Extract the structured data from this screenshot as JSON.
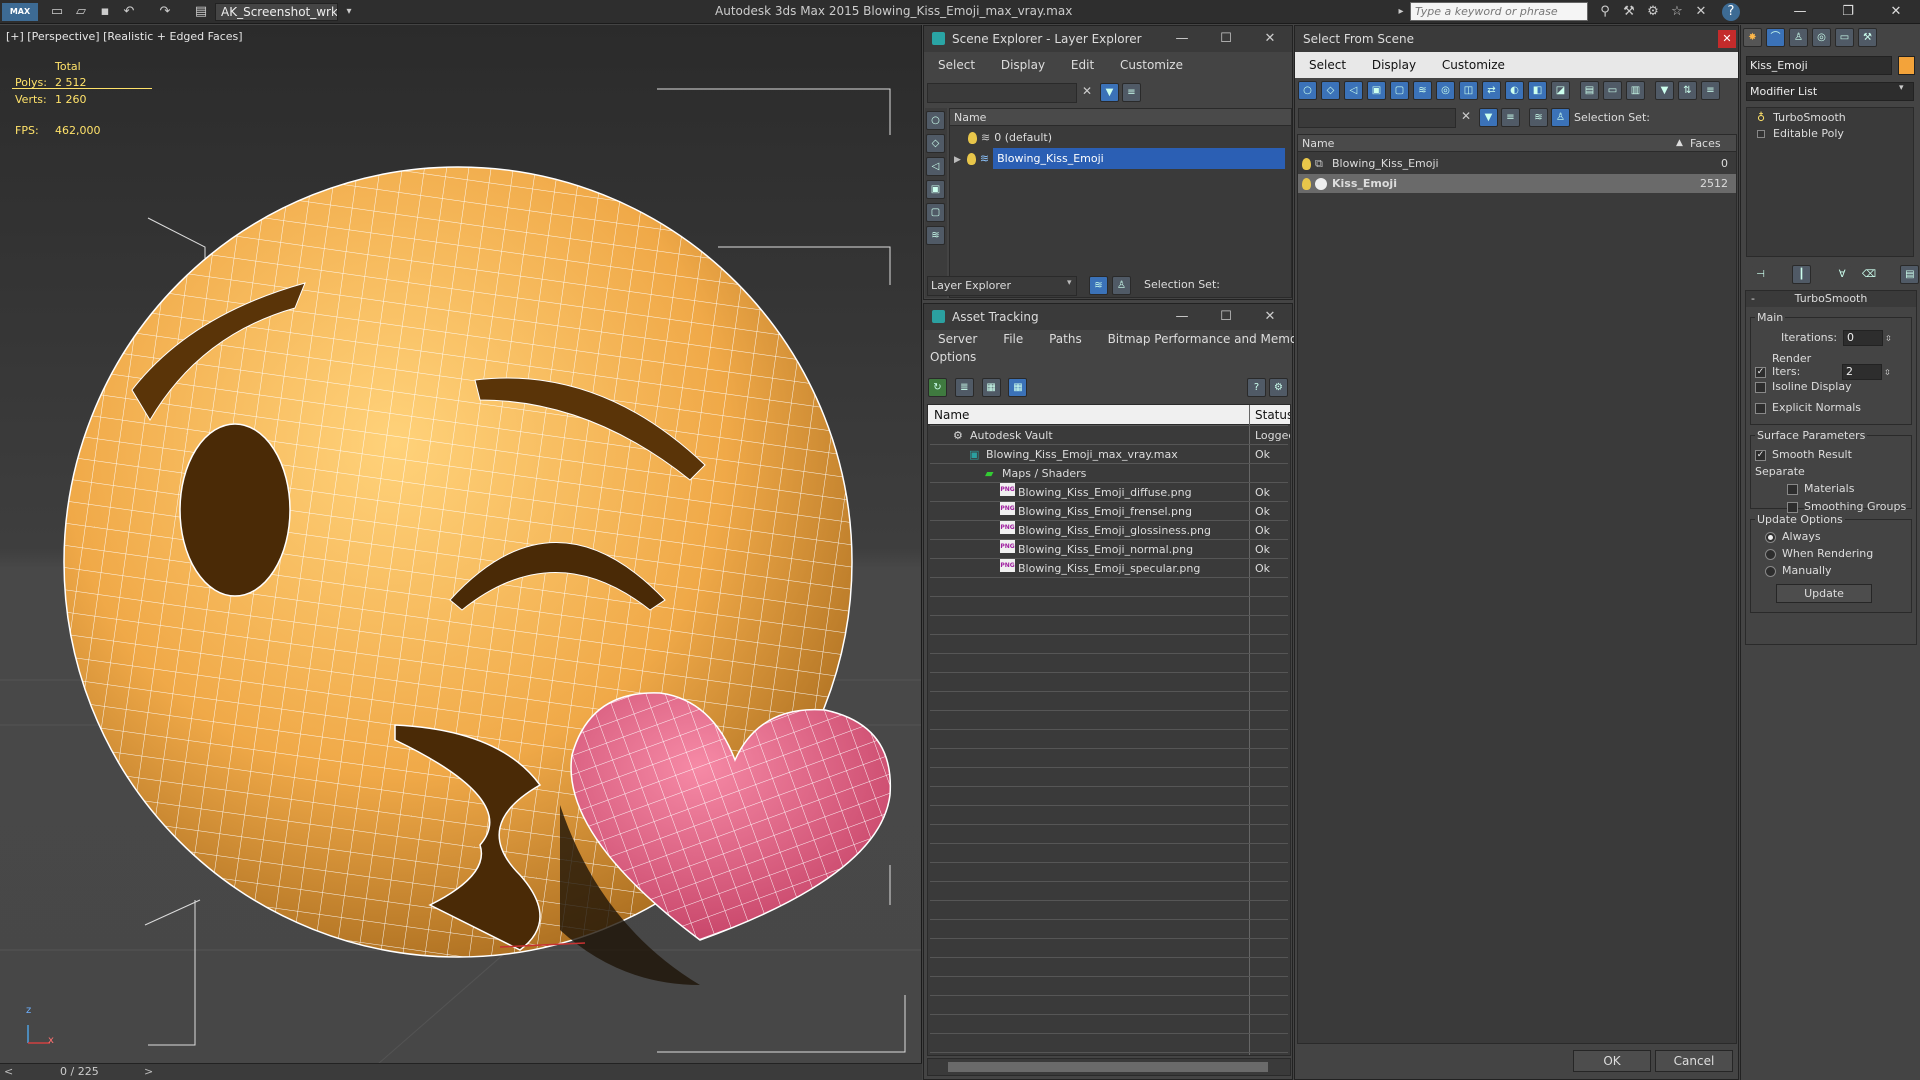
{
  "app": {
    "title": "Autodesk 3ds Max  2015     Blowing_Kiss_Emoji_max_vray.max",
    "logo": "MAX",
    "workspace": "AK_Screenshot_wrksp",
    "search_placeholder": "Type a keyword or phrase"
  },
  "viewport": {
    "label": "[+] [Perspective] [Realistic + Edged Faces]",
    "stats": {
      "total_label": "Total",
      "polys_label": "Polys:",
      "polys_value": "2 512",
      "verts_label": "Verts:",
      "verts_value": "1 260",
      "fps_label": "FPS:",
      "fps_value": "462,000"
    },
    "timeline": "0 / 225",
    "axis_z": "z",
    "axis_x": "x",
    "colors": {
      "emoji": "#f3b04e",
      "heart": "#e0527c",
      "wire": "#ffffff"
    }
  },
  "scene_explorer": {
    "title": "Scene Explorer - Layer Explorer",
    "menu": [
      "Select",
      "Display",
      "Edit",
      "Customize"
    ],
    "column": "Name",
    "rows": [
      {
        "name": "0 (default)"
      },
      {
        "name": "Blowing_Kiss_Emoji"
      }
    ],
    "footer_combo": "Layer Explorer",
    "selection_set": "Selection Set:"
  },
  "asset_tracking": {
    "title": "Asset Tracking",
    "menu": [
      "Server",
      "File",
      "Paths",
      "Bitmap Performance and Memory"
    ],
    "menu2": "Options",
    "columns": {
      "name": "Name",
      "status": "Status"
    },
    "rows": [
      {
        "name": "Autodesk Vault",
        "status": "Logged"
      },
      {
        "name": "Blowing_Kiss_Emoji_max_vray.max",
        "status": "Ok"
      },
      {
        "name": "Maps / Shaders",
        "status": ""
      },
      {
        "name": "Blowing_Kiss_Emoji_diffuse.png",
        "status": "Ok"
      },
      {
        "name": "Blowing_Kiss_Emoji_frensel.png",
        "status": "Ok"
      },
      {
        "name": "Blowing_Kiss_Emoji_glossiness.png",
        "status": "Ok"
      },
      {
        "name": "Blowing_Kiss_Emoji_normal.png",
        "status": "Ok"
      },
      {
        "name": "Blowing_Kiss_Emoji_specular.png",
        "status": "Ok"
      }
    ],
    "png_tag": "PNG"
  },
  "select_from_scene": {
    "title": "Select From Scene",
    "menu": [
      "Select",
      "Display",
      "Customize"
    ],
    "selection_set": "Selection Set:",
    "columns": {
      "name": "Name",
      "faces": "Faces"
    },
    "rows": [
      {
        "name": "Blowing_Kiss_Emoji",
        "faces": "0"
      },
      {
        "name": "Kiss_Emoji",
        "faces": "2512"
      }
    ],
    "ok": "OK",
    "cancel": "Cancel"
  },
  "command_panel": {
    "object_name": "Kiss_Emoji",
    "modifier_list": "Modifier List",
    "stack": [
      "TurboSmooth",
      "Editable Poly"
    ],
    "rollout_title": "TurboSmooth",
    "main_group": "Main",
    "iterations_label": "Iterations:",
    "iterations_value": "0",
    "render_iters_label": "Render Iters:",
    "render_iters_value": "2",
    "isoline": "Isoline Display",
    "explicit_normals": "Explicit Normals",
    "surface_group": "Surface Parameters",
    "smooth_result": "Smooth Result",
    "separate": "Separate",
    "materials": "Materials",
    "smoothing_groups": "Smoothing Groups",
    "update_group": "Update Options",
    "always": "Always",
    "when_rendering": "When Rendering",
    "manually": "Manually",
    "update_button": "Update",
    "check_mark": "✓"
  }
}
